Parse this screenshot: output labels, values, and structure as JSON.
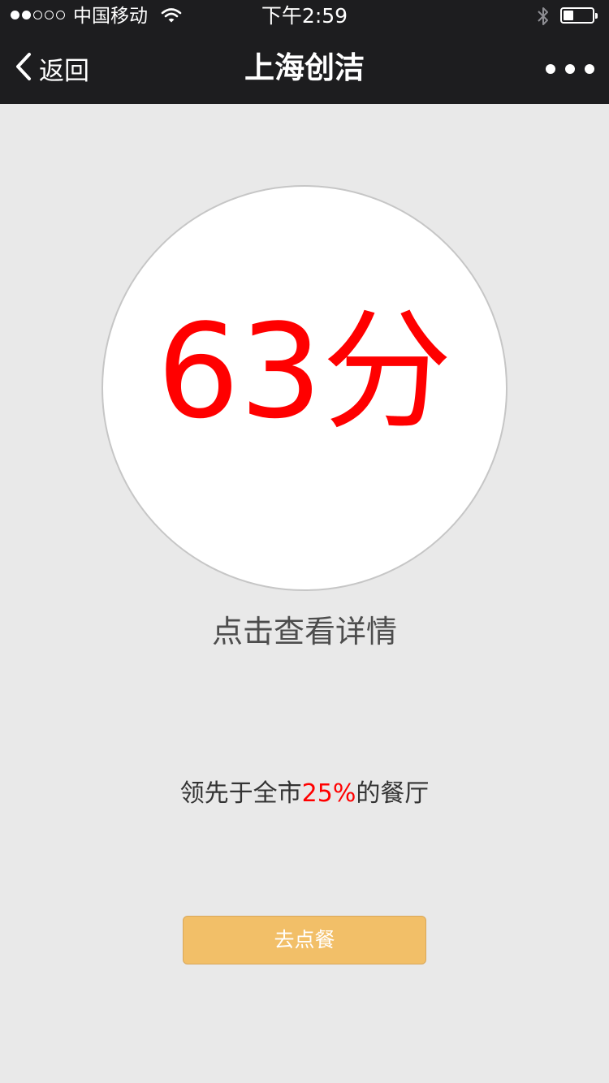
{
  "status_bar": {
    "signal_dots_filled": 2,
    "signal_dots_total": 5,
    "carrier": "中国移动",
    "time": "下午2:59",
    "battery_level": 0.35,
    "icons": [
      "wifi-icon",
      "bluetooth-icon",
      "battery-icon"
    ]
  },
  "nav": {
    "back_label": "返回",
    "title": "上海创洁",
    "icons": [
      "chevron-left-icon",
      "more-icon"
    ]
  },
  "score": {
    "value": "63分",
    "detail_link": "点击查看详情"
  },
  "rank": {
    "prefix": "领先于全市",
    "percent": "25%",
    "suffix": "的餐厅"
  },
  "actions": {
    "order_label": "去点餐"
  },
  "colors": {
    "bar_background": "#1d1d1f",
    "page_background": "#e9e9e9",
    "score_red": "#ff0000",
    "button_orange": "#f2bf68"
  }
}
